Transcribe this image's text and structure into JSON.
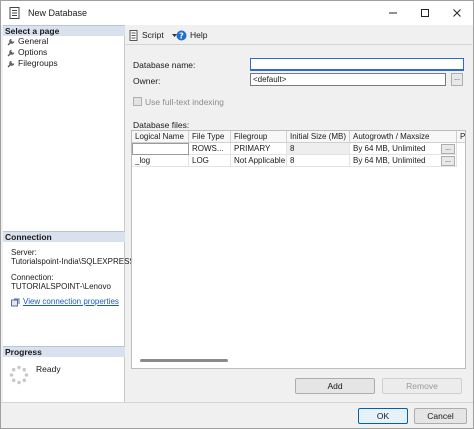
{
  "window": {
    "title": "New Database"
  },
  "sidebar": {
    "select_page_header": "Select a page",
    "pages": [
      {
        "label": "General"
      },
      {
        "label": "Options"
      },
      {
        "label": "Filegroups"
      }
    ],
    "connection_header": "Connection",
    "server_label": "Server:",
    "server_value": "Tutorialspoint-India\\SQLEXPRESS",
    "connection_label": "Connection:",
    "connection_value": "TUTORIALSPOINT-\\Lenovo",
    "view_connection_link": "View connection properties",
    "progress_header": "Progress",
    "progress_status": "Ready"
  },
  "toolbar": {
    "script_label": "Script",
    "help_label": "Help"
  },
  "form": {
    "database_name_label": "Database name:",
    "database_name_value": "",
    "owner_label": "Owner:",
    "owner_value": "<default>",
    "fulltext_label": "Use full-text indexing",
    "database_files_label": "Database files:"
  },
  "files_grid": {
    "columns": [
      "Logical Name",
      "File Type",
      "Filegroup",
      "Initial Size (MB)",
      "Autogrowth / Maxsize",
      "P"
    ],
    "rows": [
      {
        "logical_name": "",
        "file_type": "ROWS...",
        "filegroup": "PRIMARY",
        "initial_size": "8",
        "autogrowth": "By 64 MB, Unlimited",
        "button": "..."
      },
      {
        "logical_name": "_log",
        "file_type": "LOG",
        "filegroup": "Not Applicable",
        "initial_size": "8",
        "autogrowth": "By 64 MB, Unlimited",
        "button": "..."
      }
    ]
  },
  "buttons": {
    "add": "Add",
    "remove": "Remove",
    "ok": "OK",
    "cancel": "Cancel",
    "owner_browse": "..."
  }
}
